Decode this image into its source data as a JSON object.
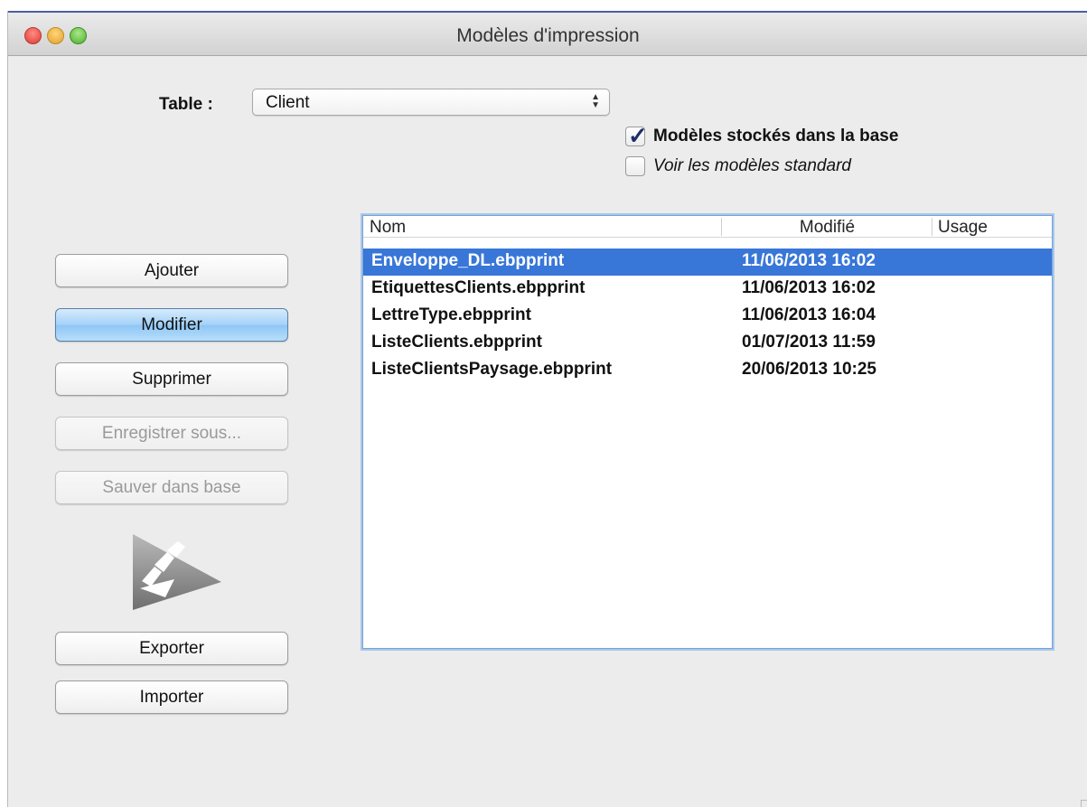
{
  "window": {
    "title": "Modèles d'impression"
  },
  "table_select": {
    "label": "Table :",
    "value": "Client"
  },
  "options": {
    "stored_in_db": {
      "label": "Modèles stockés dans la base",
      "checked": true
    },
    "show_standard": {
      "label": "Voir les modèles standard",
      "checked": false
    }
  },
  "buttons": {
    "add": "Ajouter",
    "modify": "Modifier",
    "delete": "Supprimer",
    "save_as": "Enregistrer sous...",
    "save_in_db": "Sauver dans base",
    "export": "Exporter",
    "import": "Importer"
  },
  "list": {
    "columns": {
      "name": "Nom",
      "modified": "Modifié",
      "usage": "Usage"
    },
    "rows": [
      {
        "name": "Enveloppe_DL.ebpprint",
        "modified": "11/06/2013 16:02",
        "usage": "",
        "selected": true
      },
      {
        "name": "EtiquettesClients.ebpprint",
        "modified": "11/06/2013 16:02",
        "usage": ""
      },
      {
        "name": "LettreType.ebpprint",
        "modified": "11/06/2013 16:04",
        "usage": ""
      },
      {
        "name": "ListeClients.ebpprint",
        "modified": "01/07/2013 11:59",
        "usage": ""
      },
      {
        "name": "ListeClientsPaysage.ebpprint",
        "modified": "20/06/2013 10:25",
        "usage": ""
      }
    ]
  },
  "colors": {
    "selection": "#3876d8",
    "primary_button": "#a3d2f8",
    "window_background": "#ececec"
  },
  "icons": {
    "close": "close-icon",
    "minimize": "minimize-icon",
    "zoom": "zoom-icon",
    "logo": "ebp-logo-icon",
    "select_arrows": "updown-arrows-icon",
    "checkmark": "checkmark-icon"
  }
}
